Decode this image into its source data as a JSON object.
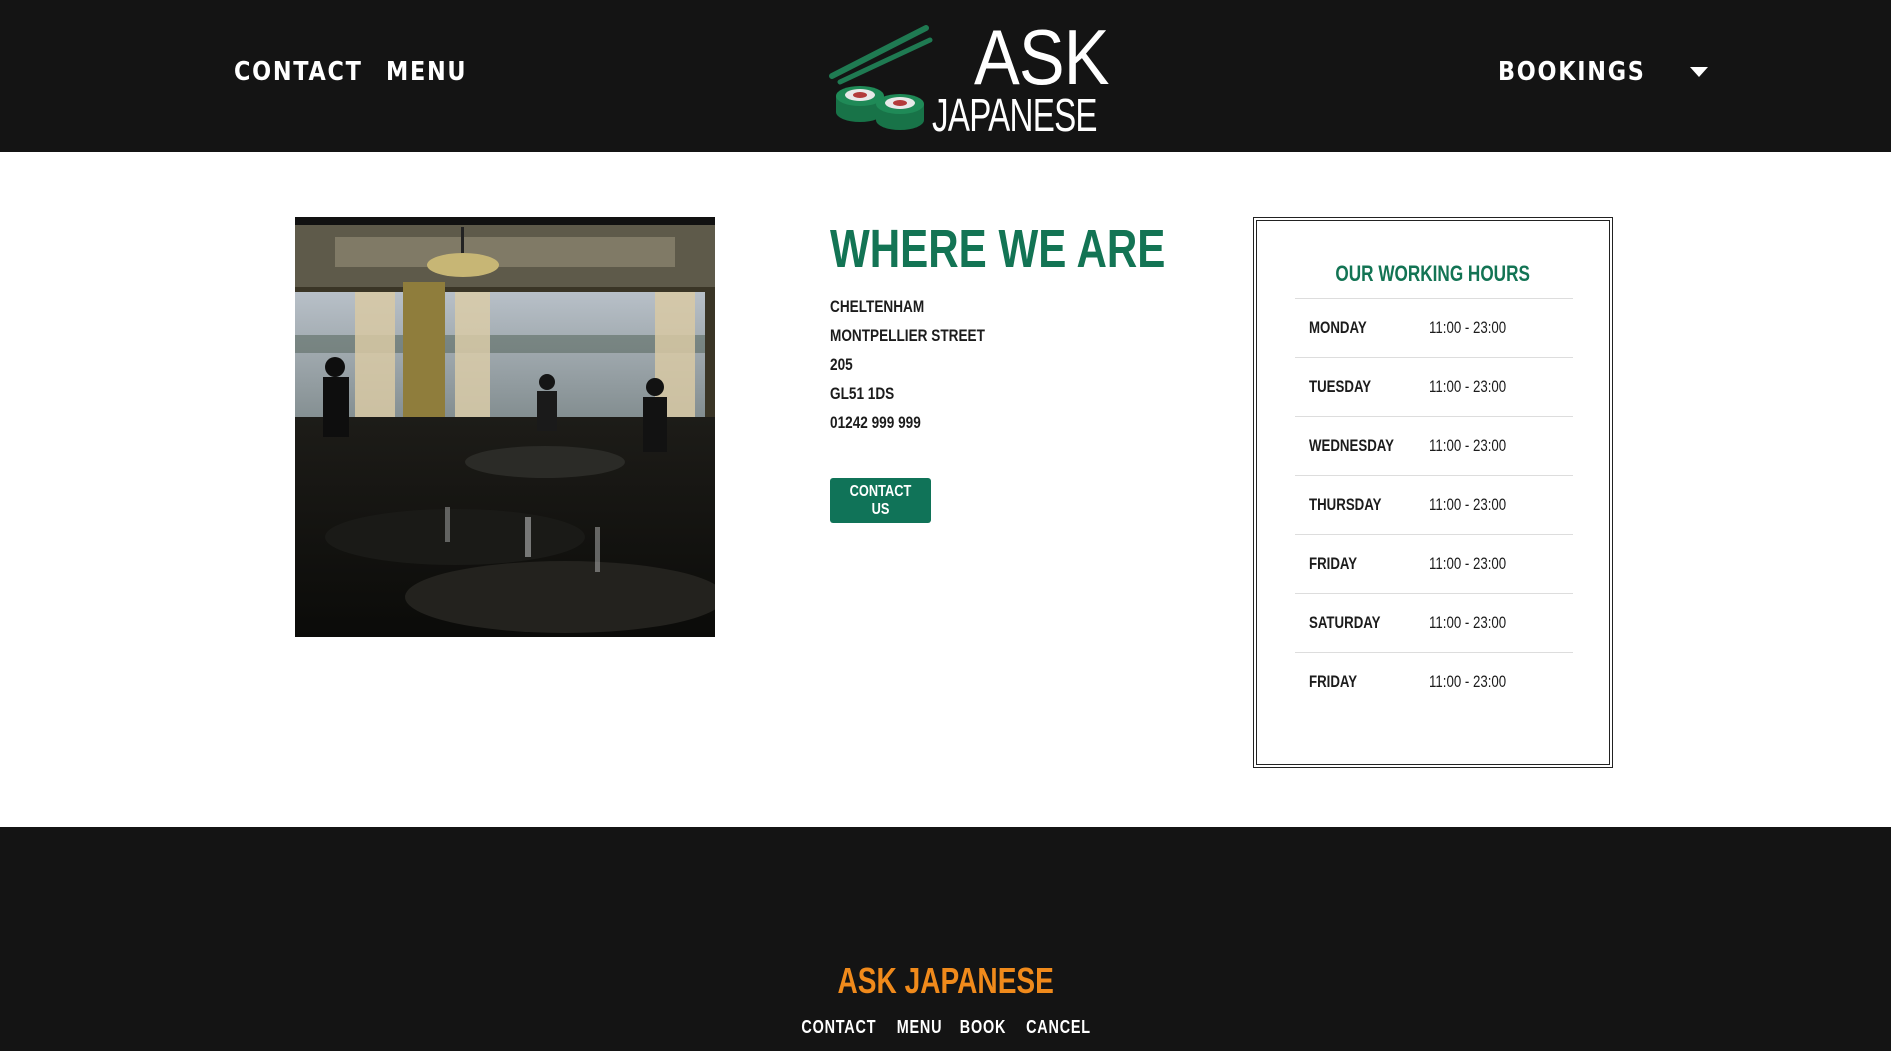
{
  "header": {
    "nav_left": [
      {
        "label": "CONTACT"
      },
      {
        "label": "MENU"
      }
    ],
    "logo": {
      "line1": "ASK",
      "line2": "JAPANESE"
    },
    "bookings_label": "BOOKINGS"
  },
  "main": {
    "photo_alt": "restaurant-interior-photo",
    "title": "WHERE WE ARE",
    "address": [
      "CHELTENHAM",
      "MONTPELLIER STREET",
      "205",
      "GL51 1DS",
      "01242 999 999"
    ],
    "contact_button": "CONTACT US"
  },
  "hours": {
    "title": "OUR WORKING HOURS",
    "rows": [
      {
        "day": "MONDAY",
        "time": "11:00 - 23:00"
      },
      {
        "day": "TUESDAY",
        "time": "11:00 - 23:00"
      },
      {
        "day": "WEDNESDAY",
        "time": "11:00 - 23:00"
      },
      {
        "day": "THURSDAY",
        "time": "11:00 - 23:00"
      },
      {
        "day": "FRIDAY",
        "time": "11:00 - 23:00"
      },
      {
        "day": "SATURDAY",
        "time": "11:00 - 23:00"
      },
      {
        "day": "FRIDAY",
        "time": "11:00 - 23:00"
      }
    ]
  },
  "footer": {
    "brand": "ASK JAPANESE",
    "links": [
      {
        "label": "CONTACT"
      },
      {
        "label": "MENU"
      },
      {
        "label": "BOOK"
      },
      {
        "label": "CANCEL"
      }
    ]
  },
  "colors": {
    "header_bg": "#141414",
    "accent_green": "#137454",
    "footer_brand": "#f08a1b"
  }
}
